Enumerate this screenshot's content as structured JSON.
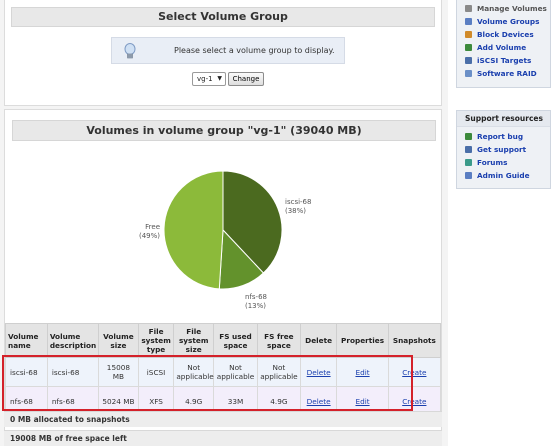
{
  "select_group": {
    "title": "Select Volume Group",
    "info": "Please select a volume group to display.",
    "selected": "vg-1",
    "button": "Change"
  },
  "volumes": {
    "title": "Volumes in volume group \"vg-1\" (39040 MB)",
    "chart_data": {
      "type": "pie",
      "slices": [
        {
          "name": "iscsi-68",
          "label": "(38%)",
          "value": 38,
          "color": "#4b6a1f"
        },
        {
          "name": "nfs-68",
          "label": "(13%)",
          "value": 13,
          "color": "#63922c"
        },
        {
          "name": "Free",
          "label": "(49%)",
          "value": 49,
          "color": "#8cba3a"
        }
      ]
    },
    "columns": [
      "Volume name",
      "Volume description",
      "Volume size",
      "File system type",
      "File system size",
      "FS used space",
      "FS free space",
      "Delete",
      "Properties",
      "Snapshots"
    ],
    "rows": [
      {
        "name": "iscsi-68",
        "desc": "iscsi-68",
        "size": "15008 MB",
        "fstype": "iSCSI",
        "fssize": "Not applicable",
        "used": "Not applicable",
        "free": "Not applicable",
        "delete": "Delete",
        "props": "Edit",
        "snap": "Create"
      },
      {
        "name": "nfs-68",
        "desc": "nfs-68",
        "size": "5024 MB",
        "fstype": "XFS",
        "fssize": "4.9G",
        "used": "33M",
        "free": "4.9G",
        "delete": "Delete",
        "props": "Edit",
        "snap": "Create"
      }
    ],
    "snapshots_summary": "0 MB allocated to snapshots",
    "free_summary": "19008 MB of free space left"
  },
  "sidebar": {
    "nav": [
      {
        "label": "Manage Volumes",
        "icon": "volumes-icon",
        "color": "#8a8a8a"
      },
      {
        "label": "Volume Groups",
        "icon": "volume-groups-icon",
        "color": "#5a7ec2"
      },
      {
        "label": "Block Devices",
        "icon": "block-devices-icon",
        "color": "#d08a2a"
      },
      {
        "label": "Add Volume",
        "icon": "add-volume-icon",
        "color": "#3c8a3c"
      },
      {
        "label": "iSCSI Targets",
        "icon": "iscsi-targets-icon",
        "color": "#4a6ea8"
      },
      {
        "label": "Software RAID",
        "icon": "software-raid-icon",
        "color": "#6a8fc7"
      }
    ],
    "support_title": "Support resources",
    "support": [
      {
        "label": "Report bug",
        "icon": "bug-icon",
        "color": "#3c8a3c"
      },
      {
        "label": "Get support",
        "icon": "support-icon",
        "color": "#4a6ea8"
      },
      {
        "label": "Forums",
        "icon": "forums-icon",
        "color": "#3a9a8a"
      },
      {
        "label": "Admin Guide",
        "icon": "guide-icon",
        "color": "#5a7ec2"
      }
    ]
  }
}
